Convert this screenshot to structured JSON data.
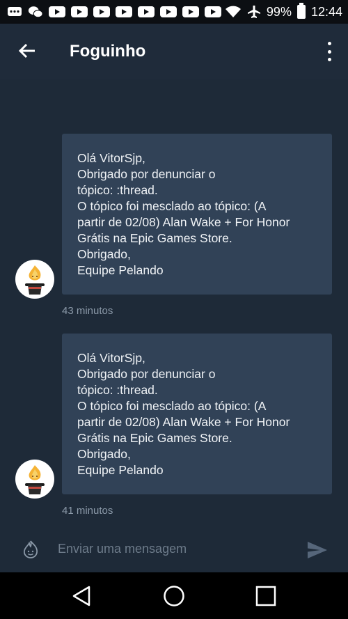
{
  "status_bar": {
    "battery": "99%",
    "time": "12:44",
    "icons": [
      "messages-icon",
      "wechat-icon",
      "youtube-icon",
      "youtube-icon",
      "youtube-icon",
      "youtube-icon",
      "youtube-icon",
      "youtube-icon",
      "youtube-icon",
      "youtube-icon",
      "wifi-icon",
      "airplane-icon",
      "battery-icon"
    ]
  },
  "header": {
    "title": "Foguinho"
  },
  "messages": [
    {
      "lines": [
        "Olá VitorSjp,",
        "Obrigado por denunciar o",
        "tópico: :thread.",
        "O tópico foi mesclado ao tópico: (A",
        "partir de 02/08) Alan Wake + For Honor",
        "Grátis na Epic Games Store.",
        "Obrigado,",
        "Equipe Pelando"
      ],
      "time": "43 minutos"
    },
    {
      "lines": [
        "Olá VitorSjp,",
        "Obrigado por denunciar o",
        "tópico: :thread.",
        "O tópico foi mesclado ao tópico: (A",
        "partir de 02/08) Alan Wake + For Honor",
        "Grátis na Epic Games Store.",
        "Obrigado,",
        "Equipe Pelando"
      ],
      "time": "41 minutos"
    }
  ],
  "composer": {
    "placeholder": "Enviar uma mensagem"
  },
  "colors": {
    "background": "#1e2a38",
    "bubble": "#314257",
    "status_bar": "#0c0f13",
    "text": "#f0f3f6",
    "muted": "#8b99a8"
  }
}
